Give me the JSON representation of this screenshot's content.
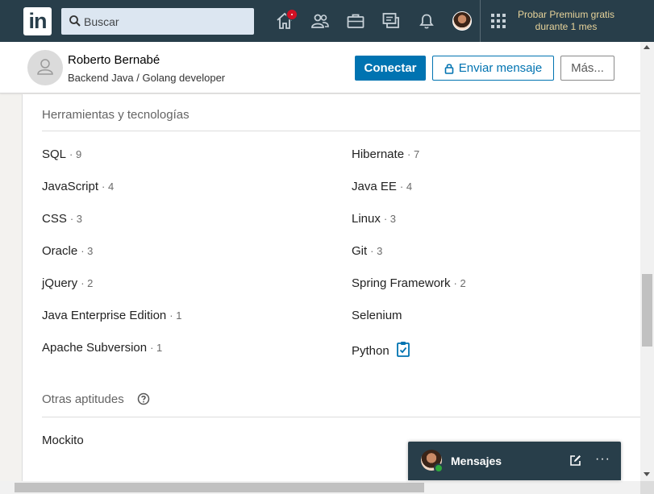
{
  "nav": {
    "logo_text": "in",
    "search_placeholder": "Buscar",
    "premium_line1": "Probar Premium gratis",
    "premium_line2": "durante 1 mes",
    "icons": [
      "home-icon",
      "network-icon",
      "jobs-icon",
      "messaging-icon",
      "notifications-icon",
      "avatar",
      "apps-grid-icon"
    ]
  },
  "profile": {
    "name": "Roberto Bernabé",
    "headline": "Backend Java / Golang developer",
    "connect_label": "Conectar",
    "message_label": "Enviar mensaje",
    "more_label": "Más..."
  },
  "tools": {
    "title": "Herramientas y tecnologías",
    "left": [
      {
        "name": "SQL",
        "count": "· 9"
      },
      {
        "name": "JavaScript",
        "count": "· 4"
      },
      {
        "name": "CSS",
        "count": "· 3"
      },
      {
        "name": "Oracle",
        "count": "· 3"
      },
      {
        "name": "jQuery",
        "count": "· 2"
      },
      {
        "name": "Java Enterprise Edition",
        "count": "· 1"
      },
      {
        "name": "Apache Subversion",
        "count": "· 1"
      }
    ],
    "right": [
      {
        "name": "Hibernate",
        "count": "· 7"
      },
      {
        "name": "Java EE",
        "count": "· 4"
      },
      {
        "name": "Linux",
        "count": "· 3"
      },
      {
        "name": "Git",
        "count": "· 3"
      },
      {
        "name": "Spring Framework",
        "count": "· 2"
      },
      {
        "name": "Selenium",
        "count": ""
      },
      {
        "name": "Python",
        "count": ""
      }
    ]
  },
  "other": {
    "title": "Otras aptitudes",
    "items": [
      "Mockito"
    ]
  },
  "messaging": {
    "label": "Mensajes",
    "more": "···"
  },
  "colors": {
    "nav_bg": "#283e4a",
    "primary": "#0073b1",
    "premium_text": "#e7d39a",
    "badge": "#d11124",
    "online": "#2ea83c"
  }
}
